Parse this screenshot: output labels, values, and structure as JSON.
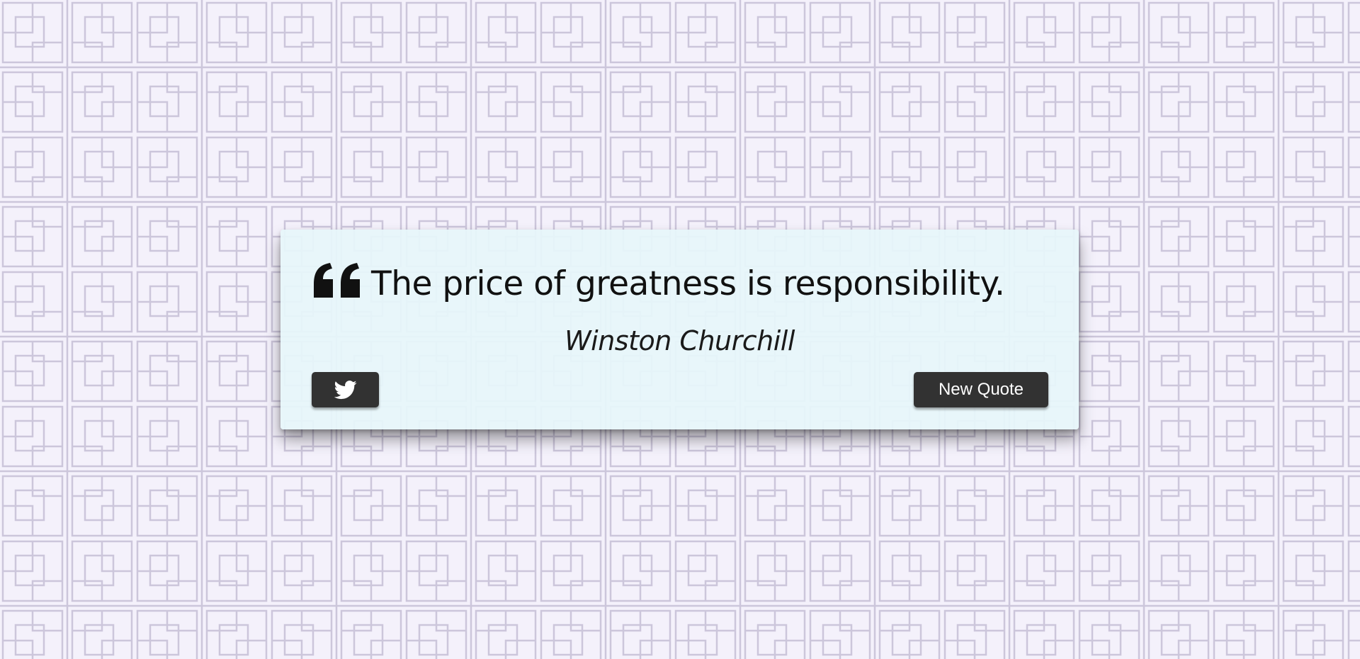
{
  "quote": {
    "text": "The price of greatness is responsibility.",
    "author": "Winston Churchill"
  },
  "actions": {
    "tweet_icon": "twitter-icon",
    "new_quote_label": "New Quote"
  },
  "icons": {
    "quote": "quote-left-icon"
  },
  "colors": {
    "background": "#f4f1fb",
    "pattern_line": "#ccc6db",
    "card": "#e6f6fa",
    "button": "#323232",
    "button_text": "#ffffff",
    "text": "#111111"
  }
}
